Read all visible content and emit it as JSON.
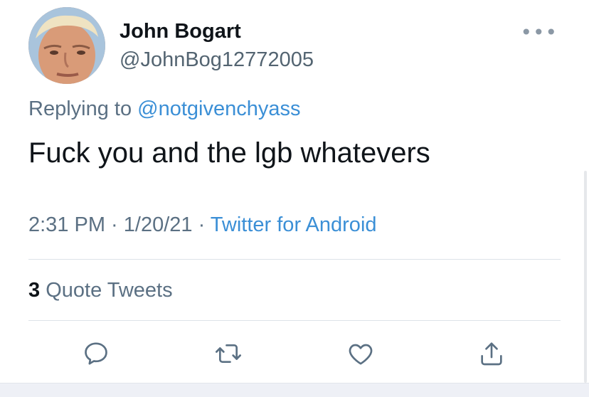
{
  "user": {
    "display_name": "John Bogart",
    "handle": "@JohnBog12772005"
  },
  "more_menu": {
    "icon": "more-horizontal-icon",
    "label": "•••"
  },
  "reply": {
    "prefix": "Replying to ",
    "mention": "@notgivenchyass"
  },
  "tweet": {
    "text": "Fuck you and the lgb whatevers",
    "time": "2:31 PM",
    "sep1": " · ",
    "date": "1/20/21",
    "sep2": " · ",
    "source": "Twitter for Android"
  },
  "stats": {
    "quote_count": "3",
    "quote_label": " Quote Tweets"
  },
  "actions": {
    "reply_icon": "reply-icon",
    "retweet_icon": "retweet-icon",
    "like_icon": "heart-icon",
    "share_icon": "share-icon"
  },
  "colors": {
    "link": "#3b8fd6",
    "muted": "#5b7083",
    "text": "#0f1419",
    "icon": "#5b7083"
  }
}
